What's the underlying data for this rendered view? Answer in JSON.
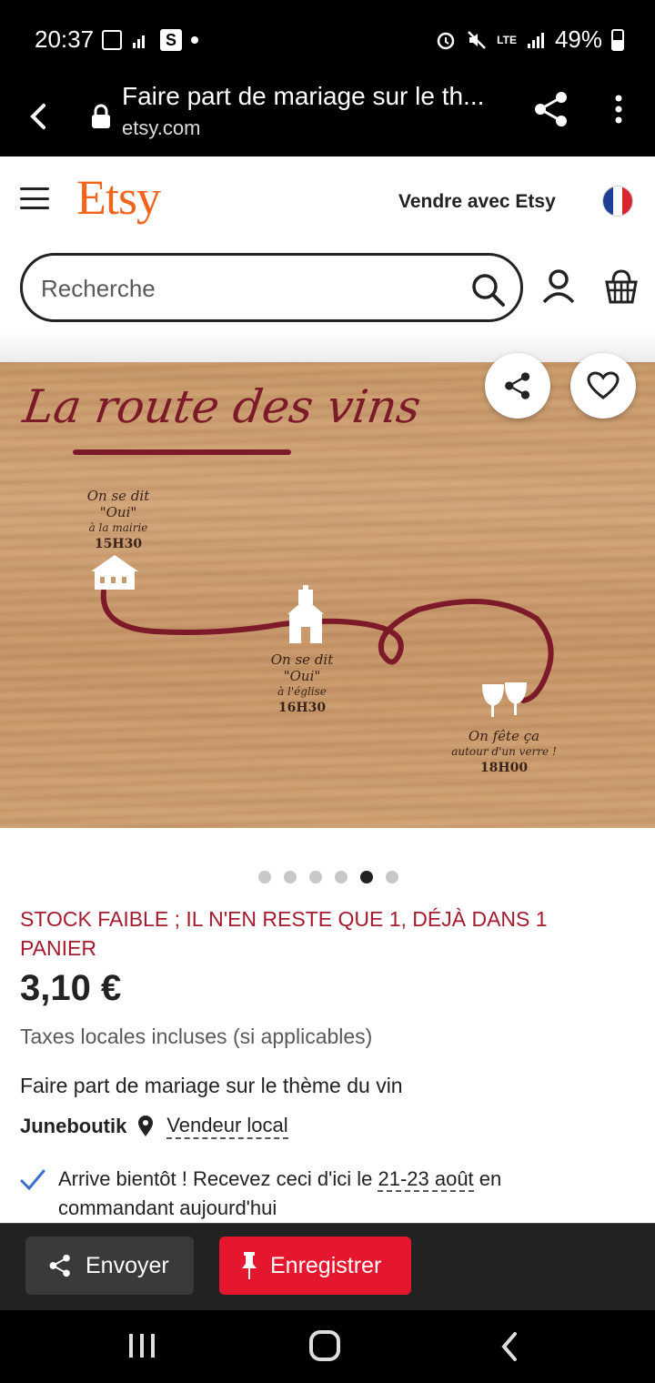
{
  "status_bar": {
    "time": "20:37",
    "left_icons": [
      "gallery-icon",
      "signal-icon",
      "s-app-icon",
      "dot"
    ],
    "s_letter": "S",
    "network": "LTE",
    "battery": "49%"
  },
  "browser": {
    "page_title": "Faire part de mariage sur le th...",
    "url": "etsy.com"
  },
  "header": {
    "logo": "Etsy",
    "sell_link": "Vendre avec Etsy"
  },
  "search": {
    "placeholder": "Recherche"
  },
  "gallery": {
    "card": {
      "title": "La route des vins",
      "events": [
        {
          "line1": "On se dit \"Oui\"",
          "line2": "à la mairie",
          "time": "15H30"
        },
        {
          "line1": "On se dit \"Oui\"",
          "line2": "à l'église",
          "time": "16H30"
        },
        {
          "line1": "On fête ça",
          "line2": "autour d'un verre !",
          "time": "18H00"
        }
      ]
    },
    "image_count": 6,
    "active_index": 4
  },
  "product": {
    "stock_notice": "STOCK FAIBLE ; IL N'EN RESTE QUE 1, DÉJÀ DANS 1 PANIER",
    "price": "3,10 €",
    "taxes": "Taxes locales incluses (si applicables)",
    "title": "Faire part de mariage sur le thème du vin",
    "seller": "Juneboutik",
    "seller_badge": "Vendeur local",
    "delivery_prefix": "Arrive bientôt ! Recevez ceci d'ici le",
    "delivery_date": "21-23 août",
    "delivery_suffix": "en commandant aujourd'hui"
  },
  "actions": {
    "send_label": "Envoyer",
    "save_label": "Enregistrer"
  },
  "colors": {
    "etsy_orange": "#F1641E",
    "stock_red": "#a61a2e",
    "save_red": "#e5172f",
    "wine": "#7c1a2a"
  }
}
